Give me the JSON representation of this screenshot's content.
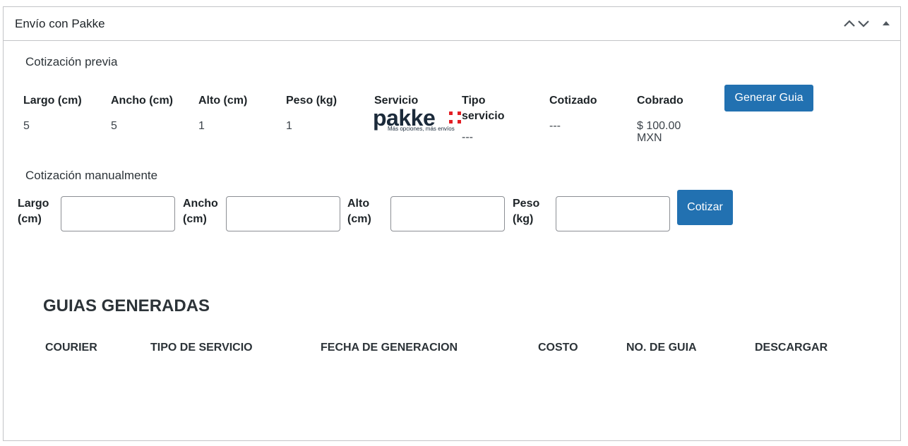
{
  "panel": {
    "title": "Envío con Pakke"
  },
  "quote_previous": {
    "section_label": "Cotización previa",
    "headers": {
      "largo": "Largo (cm)",
      "ancho": "Ancho (cm)",
      "alto": "Alto (cm)",
      "peso": "Peso (kg)",
      "servicio": "Servicio",
      "tipo_servicio": "Tipo servicio",
      "cotizado": "Cotizado",
      "cobrado": "Cobrado"
    },
    "row": {
      "largo": "5",
      "ancho": "5",
      "alto": "1",
      "peso": "1",
      "servicio_logo_word": "pakke",
      "servicio_logo_tagline": "Más opciones, más envíos",
      "tipo_servicio": "---",
      "cotizado": "---",
      "cobrado": "$ 100.00 MXN"
    },
    "generate_button": "Generar Guia"
  },
  "quote_manual": {
    "section_label": "Cotización manualmente",
    "labels": {
      "largo": "Largo (cm)",
      "ancho": "Ancho (cm)",
      "alto": "Alto (cm)",
      "peso": "Peso (kg)"
    },
    "values": {
      "largo": "",
      "ancho": "",
      "alto": "",
      "peso": ""
    },
    "quote_button": "Cotizar"
  },
  "guias": {
    "title": "GUIAS GENERADAS",
    "columns": [
      "COURIER",
      "TIPO DE SERVICIO",
      "FECHA DE GENERACION",
      "COSTO",
      "NO. DE GUIA",
      "DESCARGAR"
    ],
    "rows": []
  },
  "colors": {
    "accent": "#2271b1",
    "border": "#c3c4c7",
    "logo_text": "#1b2a3a",
    "logo_red": "#e31e24"
  },
  "icons": {
    "move_up": "chevron-up-icon",
    "move_down": "chevron-down-icon",
    "toggle": "triangle-up-icon"
  }
}
